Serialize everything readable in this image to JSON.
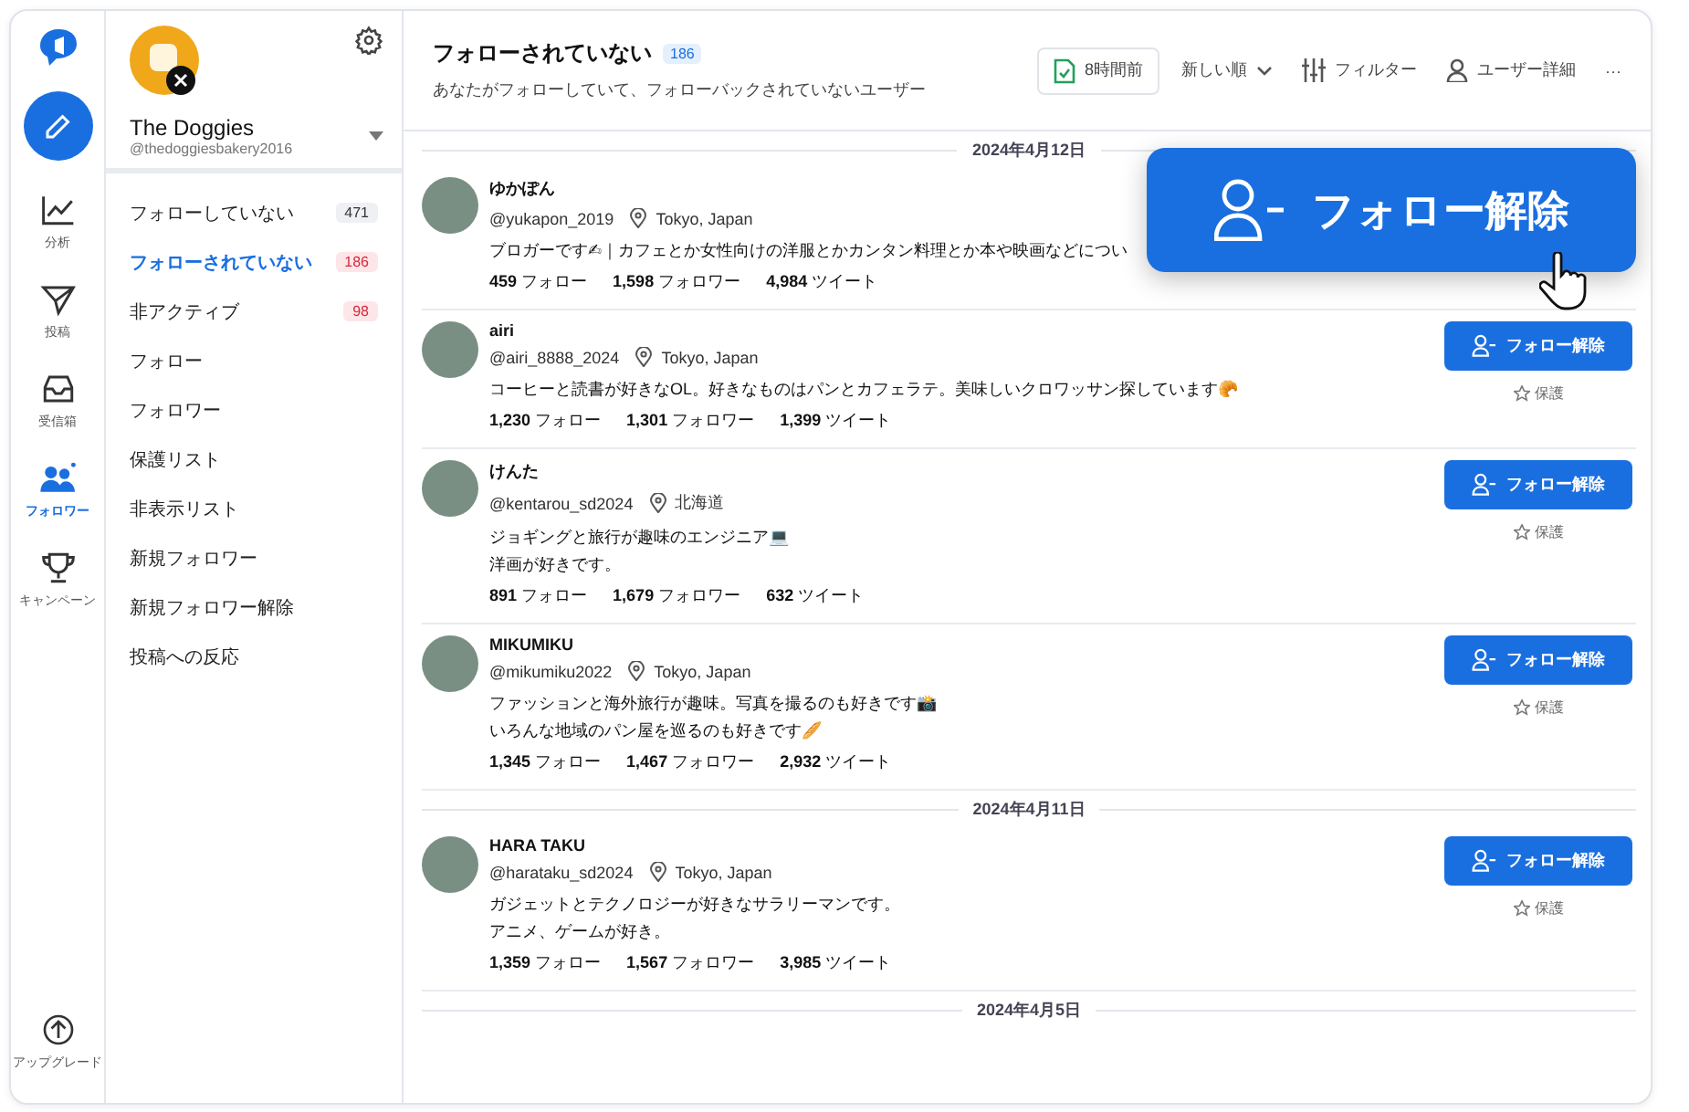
{
  "rail": {
    "items": [
      {
        "label": "分析",
        "selected": false
      },
      {
        "label": "投稿",
        "selected": false
      },
      {
        "label": "受信箱",
        "selected": false
      },
      {
        "label": "フォロワー",
        "selected": true
      },
      {
        "label": "キャンペーン",
        "selected": false
      }
    ],
    "upgrade": "アップグレード"
  },
  "account": {
    "name": "The Doggies",
    "handle": "@thedoggiesbakery2016"
  },
  "menu": [
    {
      "label": "フォローしていない",
      "count": "471",
      "kind": "neutral",
      "selected": false
    },
    {
      "label": "フォローされていない",
      "count": "186",
      "kind": "alert",
      "selected": true
    },
    {
      "label": "非アクティブ",
      "count": "98",
      "kind": "alert",
      "selected": false
    },
    {
      "label": "フォロー",
      "selected": false
    },
    {
      "label": "フォロワー",
      "selected": false
    },
    {
      "label": "保護リスト",
      "selected": false
    },
    {
      "label": "非表示リスト",
      "selected": false
    },
    {
      "label": "新規フォロワー",
      "selected": false
    },
    {
      "label": "新規フォロワー解除",
      "selected": false
    },
    {
      "label": "投稿への反応",
      "selected": false
    }
  ],
  "header": {
    "title": "フォローされていない",
    "count": "186",
    "subtitle": "あなたがフォローしていて、フォローバックされていないユーザー",
    "sync": "8時間前",
    "sort": "新しい順",
    "filter": "フィルター",
    "details": "ユーザー詳細",
    "more": "···"
  },
  "callout": {
    "label": "フォロー解除"
  },
  "groups": [
    {
      "date": "2024年4月12日",
      "users": [
        {
          "name": "ゆかぽん",
          "handle": "@yukapon_2019",
          "location": "Tokyo, Japan",
          "bio": [
            "ブロガーです✍｜カフェとか女性向けの洋服とかカンタン料理とか本や映画などについ"
          ],
          "stats": [
            "**459** フォロー",
            "**1,598** フォロワー",
            "**4,984** ツイート"
          ]
        },
        {
          "name": "airi",
          "handle": "@airi_8888_2024",
          "location": "Tokyo, Japan",
          "bio": [
            "コーヒーと読書が好きなOL。好きなものはパンとカフェラテ。美味しいクロワッサン探しています🥐"
          ],
          "stats": [
            "**1,230** フォロー",
            "**1,301** フォロワー",
            "**1,399** ツイート"
          ],
          "button": "フォロー解除",
          "protect": "保護"
        },
        {
          "name": "けんた",
          "handle": "@kentarou_sd2024",
          "location": "北海道",
          "bio": [
            "ジョギングと旅行が趣味のエンジニア💻",
            "洋画が好きです。"
          ],
          "stats": [
            "**891** フォロー",
            "**1,679** フォロワー",
            "**632** ツイート"
          ],
          "button": "フォロー解除",
          "protect": "保護"
        },
        {
          "name": "MIKUMIKU",
          "handle": "@mikumiku2022",
          "location": "Tokyo, Japan",
          "bio": [
            "ファッションと海外旅行が趣味。写真を撮るのも好きです📸",
            "いろんな地域のパン屋を巡るのも好きです🥖"
          ],
          "stats": [
            "**1,345** フォロー",
            "**1,467** フォロワー",
            "**2,932** ツイート"
          ],
          "button": "フォロー解除",
          "protect": "保護"
        }
      ]
    },
    {
      "date": "2024年4月11日",
      "users": [
        {
          "name": "HARA TAKU",
          "handle": "@harataku_sd2024",
          "location": "Tokyo, Japan",
          "bio": [
            "ガジェットとテクノロジーが好きなサラリーマンです。",
            "アニメ、ゲームが好き。"
          ],
          "stats": [
            "**1,359** フォロー",
            "**1,567** フォロワー",
            "**3,985** ツイート"
          ],
          "button": "フォロー解除",
          "protect": "保護"
        }
      ]
    },
    {
      "date": "2024年4月5日"
    }
  ]
}
